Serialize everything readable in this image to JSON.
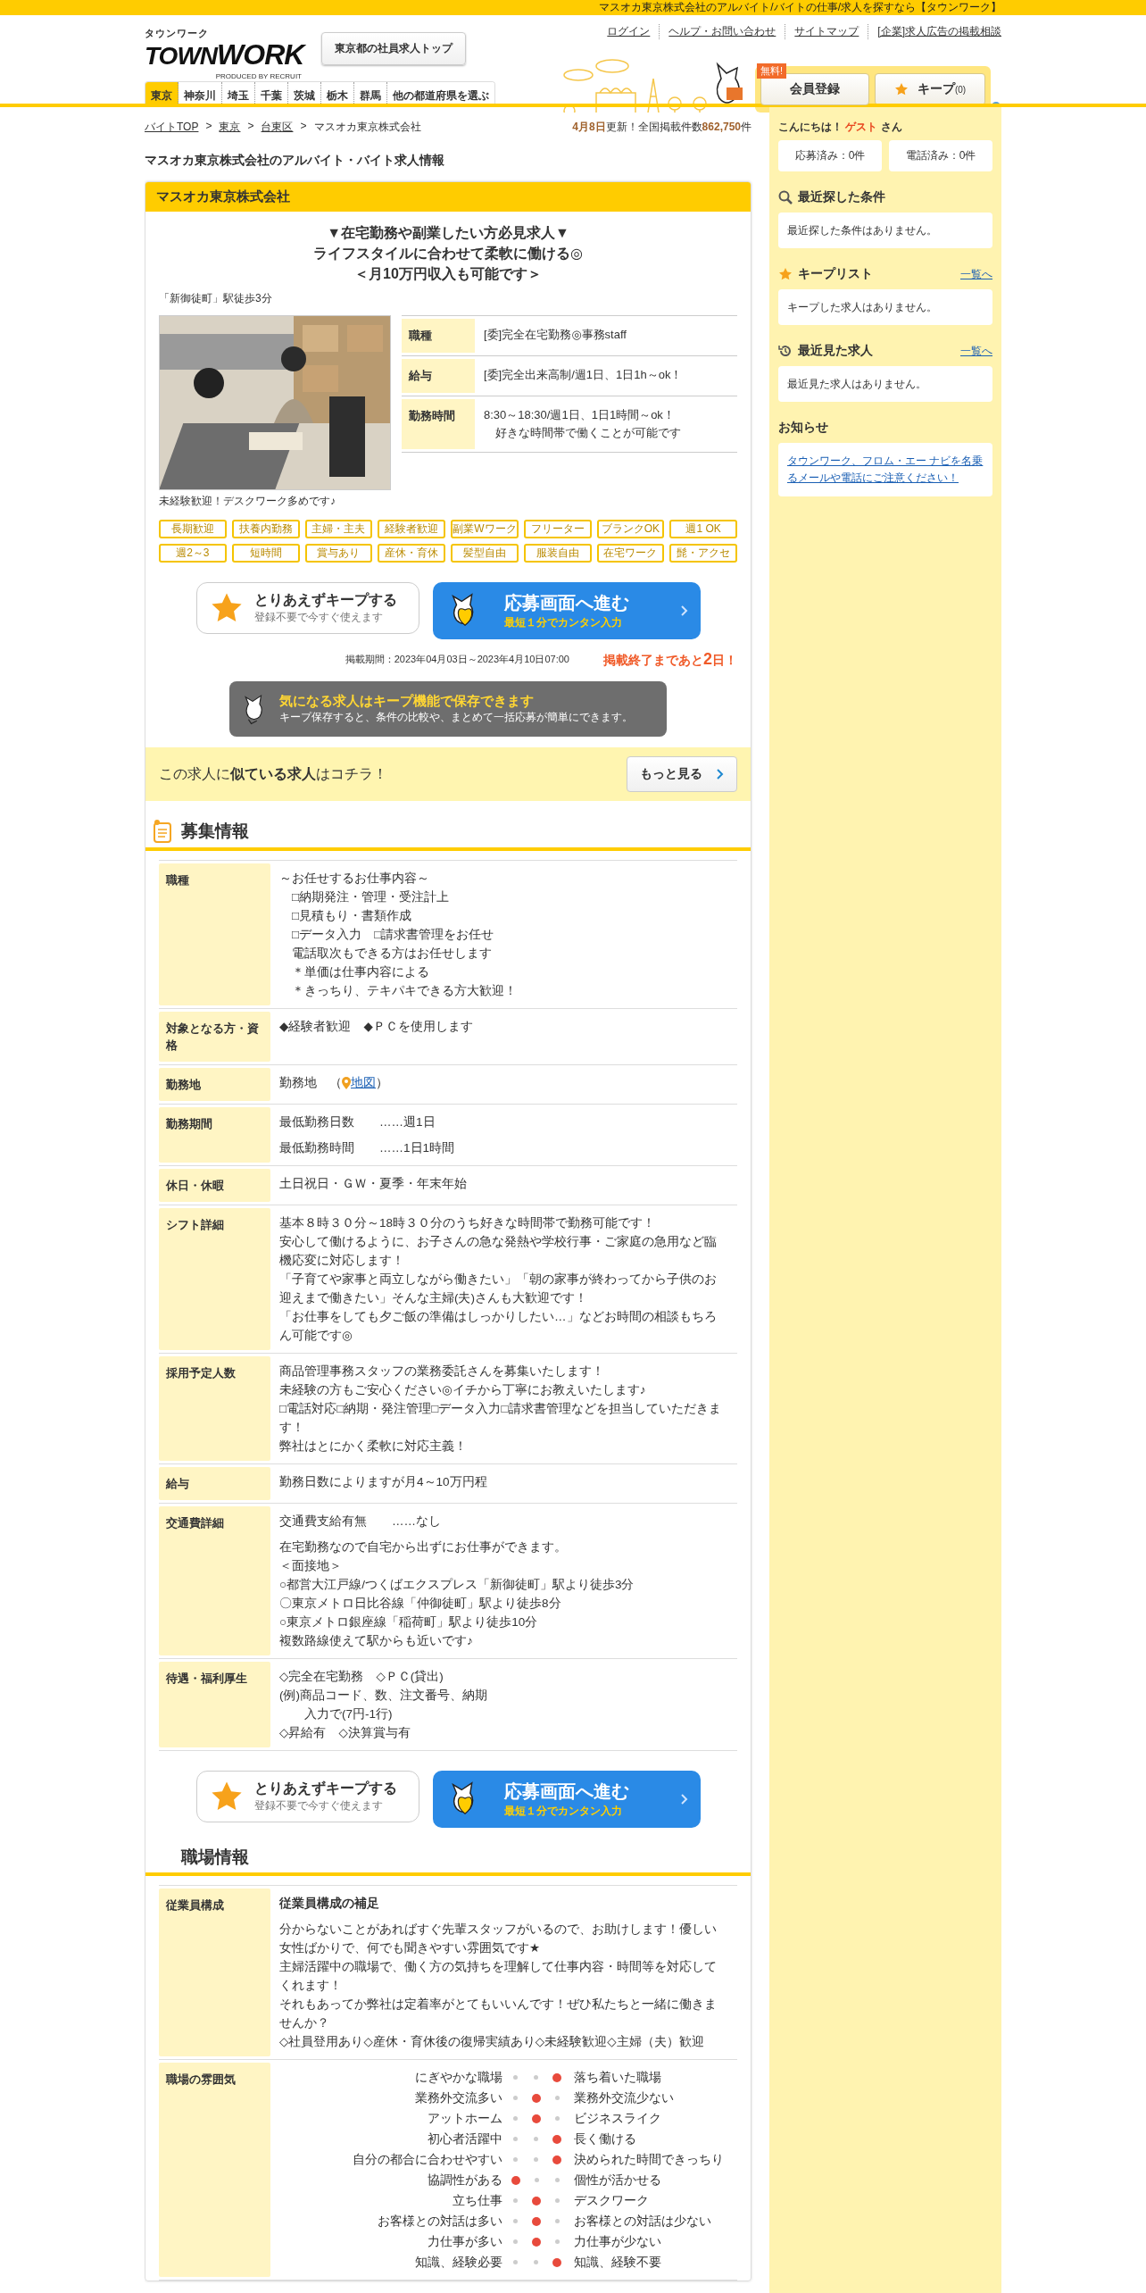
{
  "top_bar": "マスオカ東京株式会社のアルバイト/バイトの仕事/求人を探すなら【タウンワーク】",
  "header": {
    "logo": {
      "kana": "タウンワーク",
      "word_1": "TOWN",
      "word_2": "WORK",
      "credit": "PRODUCED BY RECRUIT"
    },
    "top_button": "東京都の社員求人トップ",
    "links": [
      "ログイン",
      "ヘルプ・お問い合わせ",
      "サイトマップ",
      "[企業]求人広告の掲載相談"
    ],
    "register": {
      "badge": "無料!",
      "label": "会員登録"
    },
    "keep": {
      "label": "キープ",
      "count": "(0)"
    }
  },
  "prefectures": [
    {
      "label": "東京",
      "selected": true
    },
    {
      "label": "神奈川",
      "selected": false
    },
    {
      "label": "埼玉",
      "selected": false
    },
    {
      "label": "千葉",
      "selected": false
    },
    {
      "label": "茨城",
      "selected": false
    },
    {
      "label": "栃木",
      "selected": false
    },
    {
      "label": "群馬",
      "selected": false
    },
    {
      "label": "他の都道府県を選ぶ",
      "selected": false
    }
  ],
  "breadcrumb": {
    "separator": ">",
    "items": [
      {
        "label": "バイトTOP",
        "link": true
      },
      {
        "label": "東京",
        "link": true
      },
      {
        "label": "台東区",
        "link": true
      },
      {
        "label": "マスオカ東京株式会社",
        "link": false
      }
    ]
  },
  "update": {
    "date": "4月8日",
    "text": "更新！全国掲載件数",
    "count": "862,750",
    "unit": "件"
  },
  "page_title": "マスオカ東京株式会社のアルバイト・バイト求人情報",
  "job": {
    "company": "マスオカ東京株式会社",
    "catch": [
      "▼在宅勤務や副業したい方必見求人▼",
      "ライフスタイルに合わせて柔軟に働ける◎",
      "＜月10万円収入も可能です＞"
    ],
    "station": "「新御徒町」駅徒歩3分",
    "photo_caption": "未経験歓迎！デスクワーク多めです♪",
    "summary": [
      {
        "label": "職種",
        "lines": [
          "[委]完全在宅勤務◎事務staff"
        ]
      },
      {
        "label": "給与",
        "lines": [
          "[委]完全出来高制/週1日、1日1h～ok！"
        ]
      },
      {
        "label": "勤務時間",
        "lines": [
          "8:30～18:30/週1日、1日1時間～ok！",
          "　好きな時間帯で働くことが可能です"
        ]
      }
    ],
    "tags": [
      "長期歓迎",
      "扶養内勤務",
      "主婦・主夫",
      "経験者歓迎",
      "副業Wワーク",
      "フリーター",
      "ブランクOK",
      "週1 OK",
      "週2～3",
      "短時間",
      "賞与あり",
      "産休・育休",
      "髪型自由",
      "服装自由",
      "在宅ワーク",
      "髭・アクセ"
    ],
    "keep_button": {
      "title": "とりあえずキープする",
      "sub": "登録不要で今すぐ使えます"
    },
    "apply_button": {
      "title": "応募画面へ進む",
      "sub": "最短１分でカンタン入力"
    },
    "period": "掲載期間：2023年04月03日～2023年4月10日07:00",
    "deadline": {
      "before": "掲載終了まであと",
      "number": "2",
      "after": "日！"
    },
    "keep_banner": {
      "title": "気になる求人はキープ機能で保存できます",
      "text": "キープ保存すると、条件の比較や、まとめて一括応募が簡単にできます。"
    },
    "similar": {
      "text": "この求人に**似ている求人**はコチラ！",
      "button": "もっと見る"
    }
  },
  "sections": [
    {
      "title": "募集情報",
      "has_icon": true,
      "buttons": {
        "keep_button": {
          "title": "とりあえずキープする",
          "sub": "登録不要で今すぐ使えます"
        },
        "apply_button": {
          "title": "応募画面へ進む",
          "sub": "最短１分でカンタン入力"
        }
      },
      "rows": [
        {
          "label": "職種",
          "kind": "text",
          "paragraphs": [
            [
              "～お任せするお仕事内容～",
              "　□納期発注・管理・受注計上",
              "　□見積もり・書類作成",
              "　□データ入力　□請求書管理をお任せ",
              "　電話取次もできる方はお任せします",
              "　＊単価は仕事内容による",
              "　＊きっちり、テキパキできる方大歓迎！"
            ]
          ]
        },
        {
          "label": "対象となる方・資格",
          "kind": "text",
          "paragraphs": [
            [
              "◆経験者歓迎　◆ＰＣを使用します"
            ]
          ]
        },
        {
          "label": "勤務地",
          "kind": "map",
          "prefix": "勤務地　（",
          "link": "地図",
          "suffix": "）"
        },
        {
          "label": "勤務期間",
          "kind": "text",
          "paragraphs": [
            [
              "最低勤務日数　　……週1日"
            ],
            [
              "最低勤務時間　　……1日1時間"
            ]
          ]
        },
        {
          "label": "休日・休暇",
          "kind": "text",
          "paragraphs": [
            [
              "土日祝日・ＧＷ・夏季・年末年始"
            ]
          ]
        },
        {
          "label": "シフト詳細",
          "kind": "text",
          "paragraphs": [
            [
              "基本８時３０分～18時３０分のうち好きな時間帯で勤務可能です！",
              "安心して働けるように、お子さんの急な発熱や学校行事・ご家庭の急用など臨機応変に対応します！",
              "「子育てや家事と両立しながら働きたい」「朝の家事が終わってから子供のお迎えまで働きたい」そんな主婦(夫)さんも大歓迎です！",
              "「お仕事をしても夕ご飯の準備はしっかりしたい…」などお時間の相談もちろん可能です◎"
            ]
          ]
        },
        {
          "label": "採用予定人数",
          "kind": "text",
          "paragraphs": [
            [
              "商品管理事務スタッフの業務委託さんを募集いたします！",
              "未経験の方もご安心ください◎イチから丁寧にお教えいたします♪",
              "□電話対応□納期・発注管理□データ入力□請求書管理などを担当していただきます！",
              "弊社はとにかく柔軟に対応主義！"
            ]
          ]
        },
        {
          "label": "給与",
          "kind": "text",
          "paragraphs": [
            [
              "勤務日数によりますが月4～10万円程"
            ]
          ]
        },
        {
          "label": "交通費詳細",
          "kind": "text",
          "paragraphs": [
            [
              "交通費支給有無　　……なし"
            ],
            [
              "在宅勤務なので自宅から出ずにお仕事ができます。",
              "＜面接地＞",
              "○都営大江戸線/つくばエクスプレス「新御徒町」駅より徒歩3分",
              "〇東京メトロ日比谷線「仲御徒町」駅より徒歩8分",
              "○東京メトロ銀座線「稲荷町」駅より徒歩10分",
              "複数路線使えて駅からも近いです♪"
            ]
          ]
        },
        {
          "label": "待遇・福利厚生",
          "kind": "text",
          "paragraphs": [
            [
              "◇完全在宅勤務　◇ＰＣ(貸出)",
              "(例)商品コード、数、注文番号、納期",
              "　　入力で(7円-1行)",
              "◇昇給有　◇決算賞与有"
            ]
          ]
        }
      ]
    },
    {
      "title": "職場情報",
      "has_icon": false,
      "rows": [
        {
          "label": "従業員構成",
          "kind": "text",
          "heading": "従業員構成の補足",
          "paragraphs": [
            [
              "分からないことがあればすぐ先輩スタッフがいるので、お助けします！優しい女性ばかりで、何でも聞きやすい雰囲気です★",
              "主婦活躍中の職場で、働く方の気持ちを理解して仕事内容・時間等を対応してくれます！",
              "それもあってか弊社は定着率がとてもいいんです！ぜひ私たちと一緒に働きませんか？",
              "◇社員登用あり◇産休・育休後の復帰実績あり◇未経験歓迎◇主婦（夫）歓迎"
            ]
          ]
        },
        {
          "label": "職場の雰囲気",
          "kind": "scale",
          "items": [
            {
              "left": "にぎやかな職場",
              "right": "落ち着いた職場",
              "dots": [
                {
                  "selected": false
                },
                {
                  "selected": false
                },
                {
                  "selected": true
                }
              ]
            },
            {
              "left": "業務外交流多い",
              "right": "業務外交流少ない",
              "dots": [
                {
                  "selected": false
                },
                {
                  "selected": true
                },
                {
                  "selected": false
                }
              ]
            },
            {
              "left": "アットホーム",
              "right": "ビジネスライク",
              "dots": [
                {
                  "selected": false
                },
                {
                  "selected": true
                },
                {
                  "selected": false
                }
              ]
            },
            {
              "left": "初心者活躍中",
              "right": "長く働ける",
              "dots": [
                {
                  "selected": false
                },
                {
                  "selected": false
                },
                {
                  "selected": true
                }
              ]
            },
            {
              "left": "自分の都合に合わせやすい",
              "right": "決められた時間できっちり",
              "dots": [
                {
                  "selected": false
                },
                {
                  "selected": false
                },
                {
                  "selected": true
                }
              ]
            },
            {
              "left": "協調性がある",
              "right": "個性が活かせる",
              "dots": [
                {
                  "selected": true
                },
                {
                  "selected": false
                },
                {
                  "selected": false
                }
              ]
            },
            {
              "left": "立ち仕事",
              "right": "デスクワーク",
              "dots": [
                {
                  "selected": false
                },
                {
                  "selected": true
                },
                {
                  "selected": false
                }
              ]
            },
            {
              "left": "お客様との対話は多い",
              "right": "お客様との対話は少ない",
              "dots": [
                {
                  "selected": false
                },
                {
                  "selected": true
                },
                {
                  "selected": false
                }
              ]
            },
            {
              "left": "力仕事が多い",
              "right": "力仕事が少ない",
              "dots": [
                {
                  "selected": false
                },
                {
                  "selected": true
                },
                {
                  "selected": false
                }
              ]
            },
            {
              "left": "知識、経験必要",
              "right": "知識、経験不要",
              "dots": [
                {
                  "selected": false
                },
                {
                  "selected": false
                },
                {
                  "selected": true
                }
              ]
            }
          ]
        }
      ]
    }
  ],
  "sidebar": {
    "greeting": {
      "before": "こんにちは！",
      "name": "ゲスト",
      "after": "さん"
    },
    "counters": [
      "応募済み：0件",
      "電話済み：0件"
    ],
    "panels": [
      {
        "kind": "search",
        "title": "最近探した条件",
        "text": "最近探した条件はありません。"
      },
      {
        "kind": "keep",
        "title": "キープリスト",
        "link": "一覧へ",
        "text": "キープした求人はありません。"
      },
      {
        "kind": "history",
        "title": "最近見た求人",
        "link": "一覧へ",
        "text": "最近見た求人はありません。"
      },
      {
        "kind": "notice",
        "title": "お知らせ",
        "notice_link": "タウンワーク、フロム・エー ナビを名乗るメールや電話にご注意ください！"
      }
    ]
  }
}
